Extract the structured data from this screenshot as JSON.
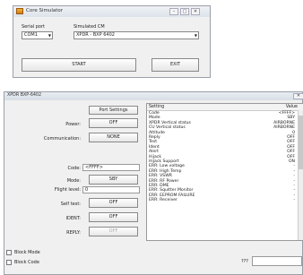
{
  "core_window": {
    "title": "Core Simulator",
    "serial_port_label": "Serial port",
    "serial_port_value": "COM1",
    "simulated_cm_label": "Simulated CM",
    "simulated_cm_value": "XPDR - BXP 6402",
    "start_label": "START",
    "exit_label": "EXIT",
    "minimize_glyph": "–",
    "maximize_glyph": "□",
    "close_glyph": "✕"
  },
  "xpdr_window": {
    "title": "XPDR BXP-6402",
    "port_settings_label": "Port Settings",
    "fields": [
      {
        "label": "Power:",
        "value": "OFF",
        "kind": "button"
      },
      {
        "label": "Communication:",
        "value": "NONE",
        "kind": "button"
      },
      {
        "label": "Code:",
        "value": "<FFFF>",
        "kind": "input"
      },
      {
        "label": "Mode:",
        "value": "SBY",
        "kind": "button"
      },
      {
        "label": "Flight level:",
        "value": "0",
        "kind": "input"
      },
      {
        "label": "Self test:",
        "value": "OFF",
        "kind": "button"
      },
      {
        "label": "IDENT:",
        "value": "OFF",
        "kind": "button"
      },
      {
        "label": "REPLY:",
        "value": "OFF",
        "kind": "button-disabled"
      }
    ],
    "block_mode_label": "Block Mode",
    "block_code_label": "Block Code",
    "table": {
      "col_setting": "Setting",
      "col_value": "Value",
      "rows": [
        {
          "setting": "Code",
          "value": "<FFFF>"
        },
        {
          "setting": "Mode",
          "value": "SBY"
        },
        {
          "setting": "XPDR Vertical status",
          "value": "AIRBORNE"
        },
        {
          "setting": "CU Vertical status",
          "value": "AIRBORNE"
        },
        {
          "setting": "Altitude",
          "value": "0"
        },
        {
          "setting": "Reply",
          "value": "OFF"
        },
        {
          "setting": "Test",
          "value": "OFF"
        },
        {
          "setting": "Ident",
          "value": "OFF"
        },
        {
          "setting": "Alert",
          "value": "OFF"
        },
        {
          "setting": "Hijack",
          "value": "OFF"
        },
        {
          "setting": "Hijack Support",
          "value": "ON"
        },
        {
          "setting": "ERR: Low voltage",
          "value": "-"
        },
        {
          "setting": "ERR: High Temp",
          "value": "-"
        },
        {
          "setting": "ERR: VSWR",
          "value": "-"
        },
        {
          "setting": "ERR: RF Power",
          "value": "-"
        },
        {
          "setting": "ERR: DME",
          "value": "-"
        },
        {
          "setting": "ERR: Squitter Monitor",
          "value": "-"
        },
        {
          "setting": "ERR: EEPROM FAILURE",
          "value": "-"
        },
        {
          "setting": "ERR: Receiver",
          "value": "-"
        }
      ]
    },
    "status_text": "???",
    "close_glyph": "✕"
  }
}
